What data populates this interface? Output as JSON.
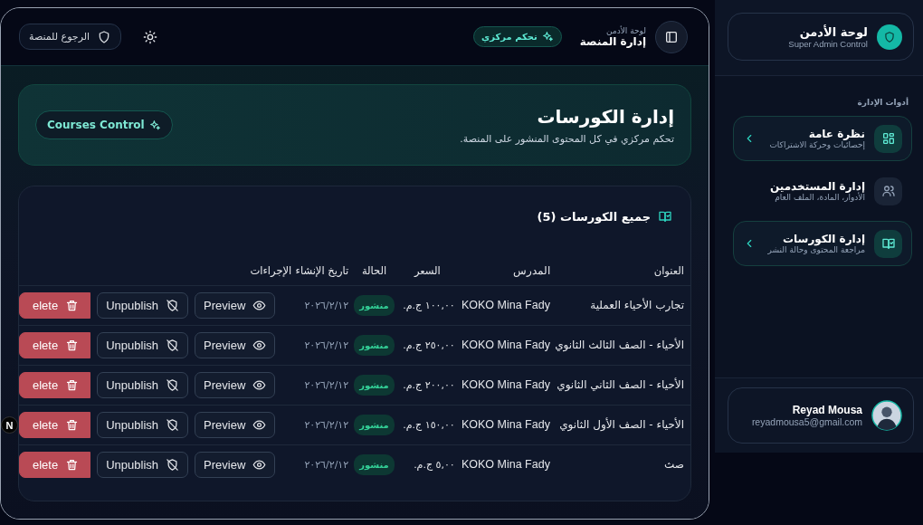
{
  "sidebar": {
    "brand": {
      "title": "لوحة الأدمن",
      "subtitle": "Super Admin Control"
    },
    "section_label": "أدوات الإدارة",
    "items": [
      {
        "title": "نظرة عامة",
        "subtitle": "إحصائيات وحركة الاشتراكات",
        "selected": true
      },
      {
        "title": "إدارة المستخدمين",
        "subtitle": "الأدوار، المادة، الملف العام",
        "selected": false
      },
      {
        "title": "إدارة الكورسات",
        "subtitle": "مراجعة المحتوى وحالة النشر",
        "selected": true
      }
    ],
    "user": {
      "name": "Reyad Mousa",
      "email": "reyadmousa5@gmail.com"
    }
  },
  "header": {
    "overline": "لوحة الأدمن",
    "title": "إدارة المنصة",
    "badge": "تحكم مركزي",
    "back_button": "الرجوع للمنصة"
  },
  "hero": {
    "title": "إدارة الكورسات",
    "description": "تحكم مركزي في كل المحتوى المنشور على المنصة.",
    "badge": "Courses Control"
  },
  "table": {
    "title": "جميع الكورسات (5)",
    "columns": [
      "العنوان",
      "المدرس",
      "السعر",
      "الحالة",
      "تاريخ الإنشاء",
      "الإجراءات"
    ],
    "rows": [
      {
        "title": "تجارب الأحياء العملية",
        "teacher": "KOKO Mina Fady",
        "price": "١٠٠,٠٠ ج.م.",
        "status": "منشور",
        "date": "٢٠٢٦/٢/١٢",
        "actions": [
          "Preview",
          "Unpublish",
          "elete"
        ]
      },
      {
        "title": "الأحياء - الصف الثالث الثانوي",
        "teacher": "KOKO Mina Fady",
        "price": "٢٥٠,٠٠ ج.م.",
        "status": "منشور",
        "date": "٢٠٢٦/٢/١٢",
        "actions": [
          "Preview",
          "Unpublish",
          "elete"
        ]
      },
      {
        "title": "الأحياء - الصف الثاني الثانوي",
        "teacher": "KOKO Mina Fady",
        "price": "٢٠٠,٠٠ ج.م.",
        "status": "منشور",
        "date": "٢٠٢٦/٢/١٢",
        "actions": [
          "Preview",
          "Unpublish",
          "elete"
        ]
      },
      {
        "title": "الأحياء - الصف الأول الثانوي",
        "teacher": "KOKO Mina Fady",
        "price": "١٥٠,٠٠ ج.م.",
        "status": "منشور",
        "date": "٢٠٢٦/٢/١٢",
        "actions": [
          "Preview",
          "Unpublish",
          "elete"
        ]
      },
      {
        "title": "صث",
        "teacher": "KOKO Mina Fady",
        "price": "٥,٠٠ ج.م.",
        "status": "منشور",
        "date": "٢٠٢٦/٢/١٢",
        "actions": [
          "Preview",
          "Unpublish",
          "elete"
        ]
      }
    ]
  },
  "dev_badge": "N"
}
